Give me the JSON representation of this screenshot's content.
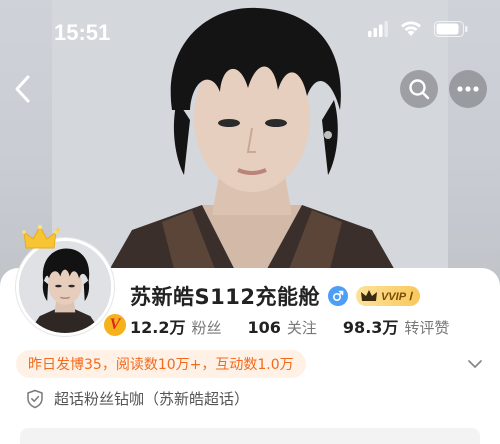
{
  "status_bar": {
    "time": "15:51",
    "icons": [
      "signal-icon",
      "wifi-icon",
      "battery-icon"
    ]
  },
  "nav": {
    "back_icon": "chevron-left-icon",
    "search_icon": "search-icon",
    "more_icon": "more-icon"
  },
  "profile": {
    "name": "苏新皓S112充能舱",
    "gender_icon": "male-icon",
    "vip_label": "VVIP Ⅰ",
    "verified_badge": "V",
    "stats": [
      {
        "value": "12.2万",
        "label": "粉丝"
      },
      {
        "value": "106",
        "label": "关注"
      },
      {
        "value": "98.3万",
        "label": "转评赞"
      }
    ],
    "summary": "昨日发博35，阅读数10万+，互动数1.0万",
    "supertopic": "超话粉丝钻咖（苏新皓超话）"
  },
  "colors": {
    "accent_orange": "#f26a1b",
    "summary_bg": "#fff1e6",
    "vip_gold": "#f8c85c",
    "gender_blue": "#4c9ef6"
  }
}
